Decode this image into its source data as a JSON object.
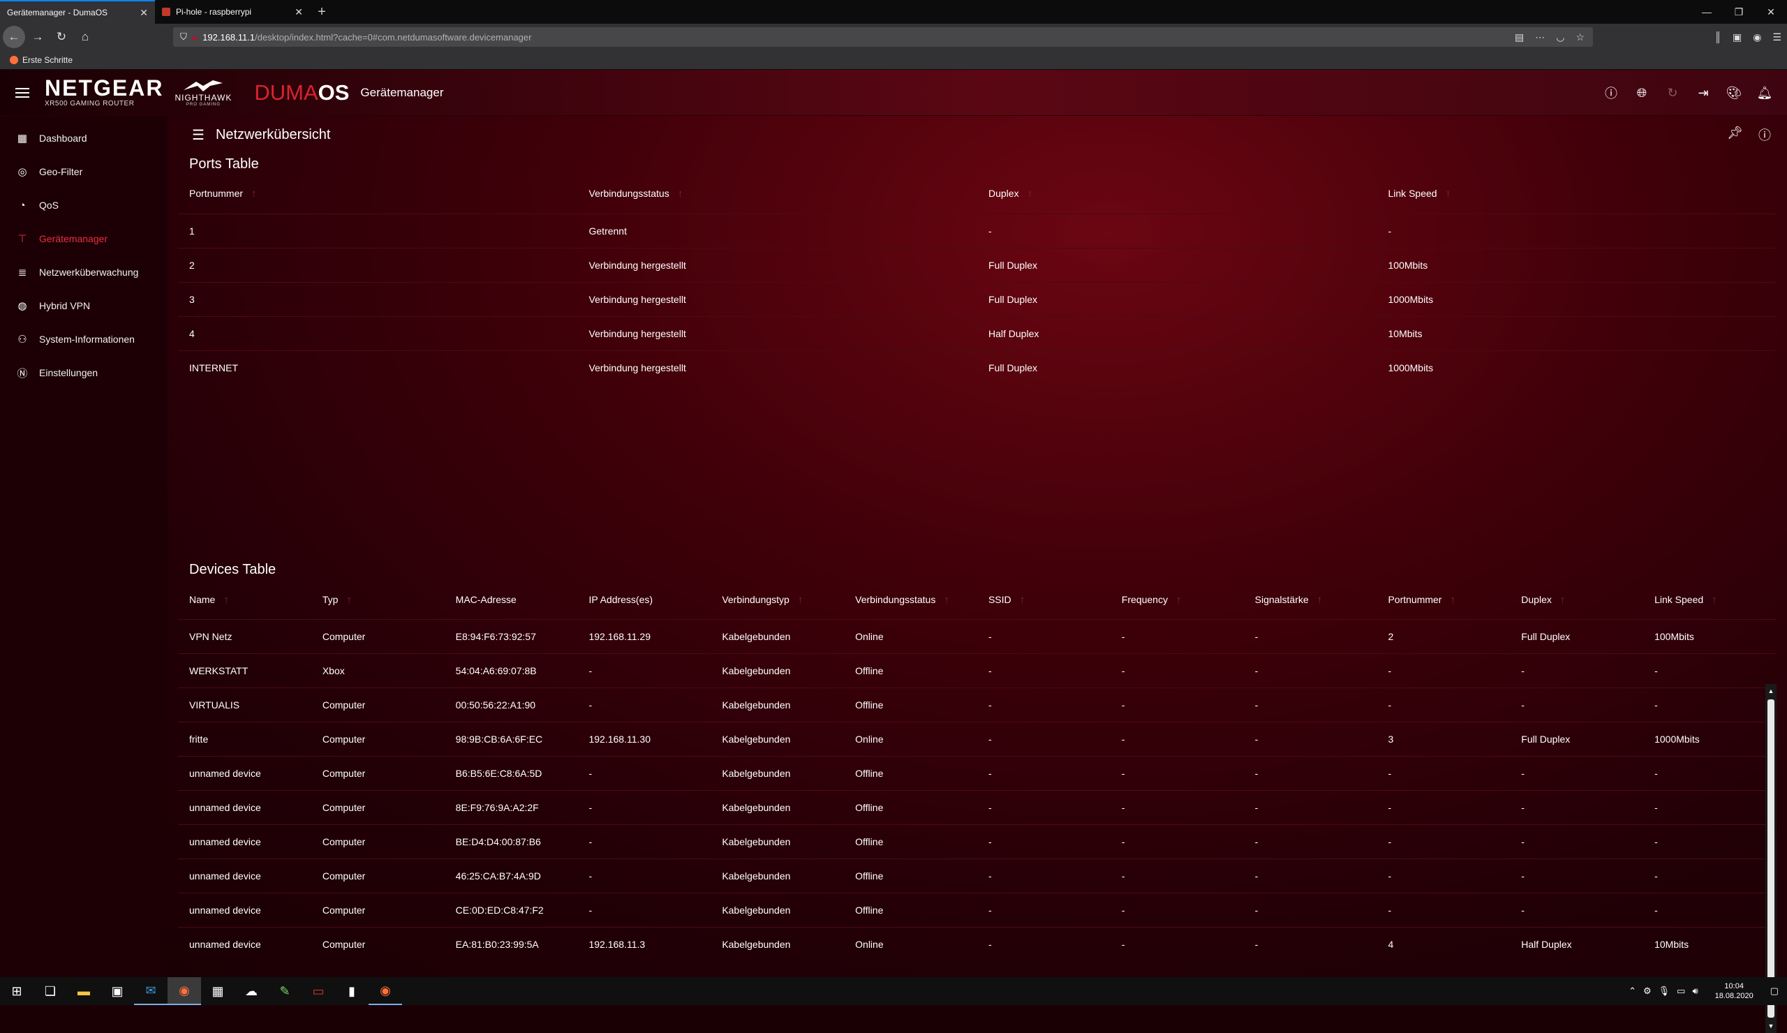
{
  "browser": {
    "tabs": [
      {
        "title": "Gerätemanager - DumaOS",
        "active": true
      },
      {
        "title": "Pi-hole - raspberrypi",
        "active": false
      }
    ],
    "url_host": "192.168.11.1",
    "url_rest": "/desktop/index.html?cache=0#com.netdumasoftware.devicemanager",
    "bookmark": "Erste Schritte"
  },
  "header": {
    "brand": "NETGEAR",
    "brand_sub": "XR500 GAMING ROUTER",
    "nighthawk": "NIGHTHAWK",
    "nighthawk_sub": "PRO GAMING",
    "duma": "DUMA",
    "os": "OS",
    "page_title": "Gerätemanager"
  },
  "sidebar": {
    "items": [
      {
        "label": "Dashboard",
        "icon": "dashboard-icon"
      },
      {
        "label": "Geo-Filter",
        "icon": "geo-filter-icon"
      },
      {
        "label": "QoS",
        "icon": "qos-icon"
      },
      {
        "label": "Gerätemanager",
        "icon": "device-manager-icon",
        "active": true
      },
      {
        "label": "Netzwerküberwachung",
        "icon": "network-monitor-icon"
      },
      {
        "label": "Hybrid VPN",
        "icon": "vpn-icon"
      },
      {
        "label": "System-Informationen",
        "icon": "system-info-icon"
      },
      {
        "label": "Einstellungen",
        "icon": "settings-icon"
      }
    ]
  },
  "content": {
    "title": "Netzwerkübersicht"
  },
  "ports": {
    "title": "Ports Table",
    "headers": [
      "Portnummer",
      "Verbindungsstatus",
      "Duplex",
      "Link Speed"
    ],
    "rows": [
      [
        "1",
        "Getrennt",
        "-",
        "-"
      ],
      [
        "2",
        "Verbindung hergestellt",
        "Full Duplex",
        "100Mbits"
      ],
      [
        "3",
        "Verbindung hergestellt",
        "Full Duplex",
        "1000Mbits"
      ],
      [
        "4",
        "Verbindung hergestellt",
        "Half Duplex",
        "10Mbits"
      ],
      [
        "INTERNET",
        "Verbindung hergestellt",
        "Full Duplex",
        "1000Mbits"
      ]
    ]
  },
  "devices": {
    "title": "Devices Table",
    "headers": [
      "Name",
      "Typ",
      "MAC-Adresse",
      "IP Address(es)",
      "Verbindungstyp",
      "Verbindungsstatus",
      "SSID",
      "Frequency",
      "Signalstärke",
      "Portnummer",
      "Duplex",
      "Link Speed"
    ],
    "sortable": [
      true,
      true,
      false,
      false,
      true,
      true,
      true,
      true,
      true,
      true,
      true,
      true
    ],
    "rows": [
      [
        "VPN Netz",
        "Computer",
        "E8:94:F6:73:92:57",
        "192.168.11.29",
        "Kabelgebunden",
        "Online",
        "-",
        "-",
        "-",
        "2",
        "Full Duplex",
        "100Mbits"
      ],
      [
        "WERKSTATT",
        "Xbox",
        "54:04:A6:69:07:8B",
        "-",
        "Kabelgebunden",
        "Offline",
        "-",
        "-",
        "-",
        "-",
        "-",
        "-"
      ],
      [
        "VIRTUALIS",
        "Computer",
        "00:50:56:22:A1:90",
        "-",
        "Kabelgebunden",
        "Offline",
        "-",
        "-",
        "-",
        "-",
        "-",
        "-"
      ],
      [
        "fritte",
        "Computer",
        "98:9B:CB:6A:6F:EC",
        "192.168.11.30",
        "Kabelgebunden",
        "Online",
        "-",
        "-",
        "-",
        "3",
        "Full Duplex",
        "1000Mbits"
      ],
      [
        "unnamed device",
        "Computer",
        "B6:B5:6E:C8:6A:5D",
        "-",
        "Kabelgebunden",
        "Offline",
        "-",
        "-",
        "-",
        "-",
        "-",
        "-"
      ],
      [
        "unnamed device",
        "Computer",
        "8E:F9:76:9A:A2:2F",
        "-",
        "Kabelgebunden",
        "Offline",
        "-",
        "-",
        "-",
        "-",
        "-",
        "-"
      ],
      [
        "unnamed device",
        "Computer",
        "BE:D4:D4:00:87:B6",
        "-",
        "Kabelgebunden",
        "Offline",
        "-",
        "-",
        "-",
        "-",
        "-",
        "-"
      ],
      [
        "unnamed device",
        "Computer",
        "46:25:CA:B7:4A:9D",
        "-",
        "Kabelgebunden",
        "Offline",
        "-",
        "-",
        "-",
        "-",
        "-",
        "-"
      ],
      [
        "unnamed device",
        "Computer",
        "CE:0D:ED:C8:47:F2",
        "-",
        "Kabelgebunden",
        "Offline",
        "-",
        "-",
        "-",
        "-",
        "-",
        "-"
      ],
      [
        "unnamed device",
        "Computer",
        "EA:81:B0:23:99:5A",
        "192.168.11.3",
        "Kabelgebunden",
        "Online",
        "-",
        "-",
        "-",
        "4",
        "Half Duplex",
        "10Mbits"
      ]
    ]
  },
  "taskbar": {
    "time": "10:04",
    "date": "18.08.2020"
  }
}
